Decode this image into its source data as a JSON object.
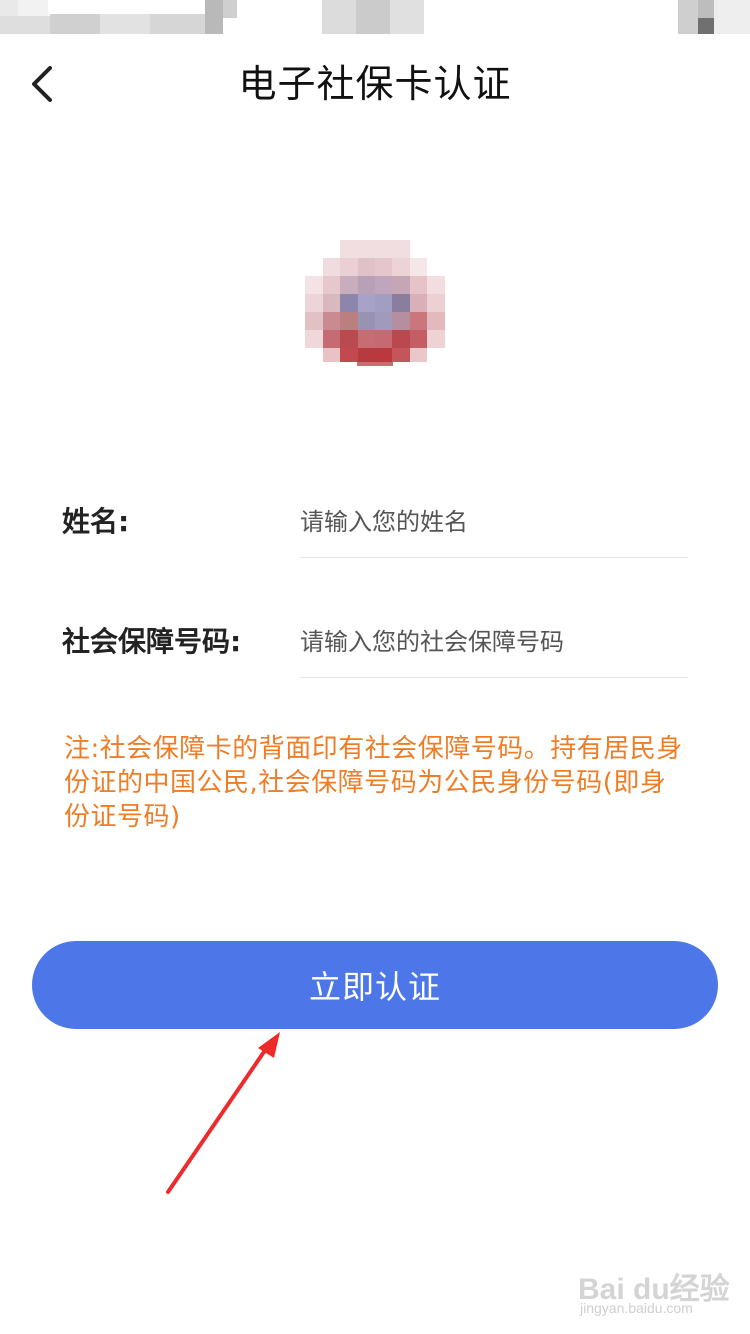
{
  "header": {
    "title": "电子社保卡认证"
  },
  "form": {
    "name_label": "姓名:",
    "name_placeholder": "请输入您的姓名",
    "ssn_label": "社会保障号码:",
    "ssn_placeholder": "请输入您的社会保障号码"
  },
  "note": "注:社会保障卡的背面印有社会保障号码。持有居民身份证的中国公民,社会保障号码为公民身份号码(即身份证号码)",
  "submit_label": "立即认证",
  "watermark": {
    "main": "Bai du经验",
    "sub": "jingyan.baidu.com"
  },
  "colors": {
    "accent": "#4d77e9",
    "note": "#ef7d27",
    "annotation_arrow": "#ee2b2b"
  }
}
